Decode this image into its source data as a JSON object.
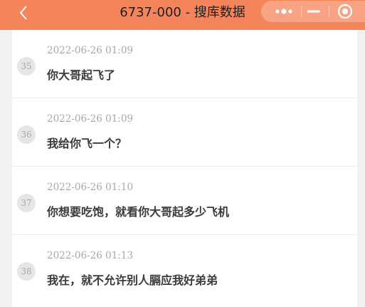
{
  "header": {
    "title": "6737-000 - 搜库数据",
    "back_icon": "chevron-left-icon",
    "more_icon": "more-dots-icon",
    "minimize_icon": "minimize-icon",
    "close_icon": "target-close-icon"
  },
  "colors": {
    "header_bg": "#f6845a",
    "background": "#f1f1f1",
    "card": "#ffffff",
    "muted_text": "#a8a8a8",
    "message_text": "#3a3a3a"
  },
  "messages": [
    {
      "number": "35",
      "time": "2022-06-26 01:09",
      "text": "你大哥起飞了"
    },
    {
      "number": "36",
      "time": "2022-06-26 01:09",
      "text": "我给你飞一个？"
    },
    {
      "number": "37",
      "time": "2022-06-26 01:10",
      "text": "你想要吃饱，就看你大哥起多少飞机"
    },
    {
      "number": "38",
      "time": "2022-06-26 01:13",
      "text": "我在，就不允许别人膈应我好弟弟"
    }
  ]
}
